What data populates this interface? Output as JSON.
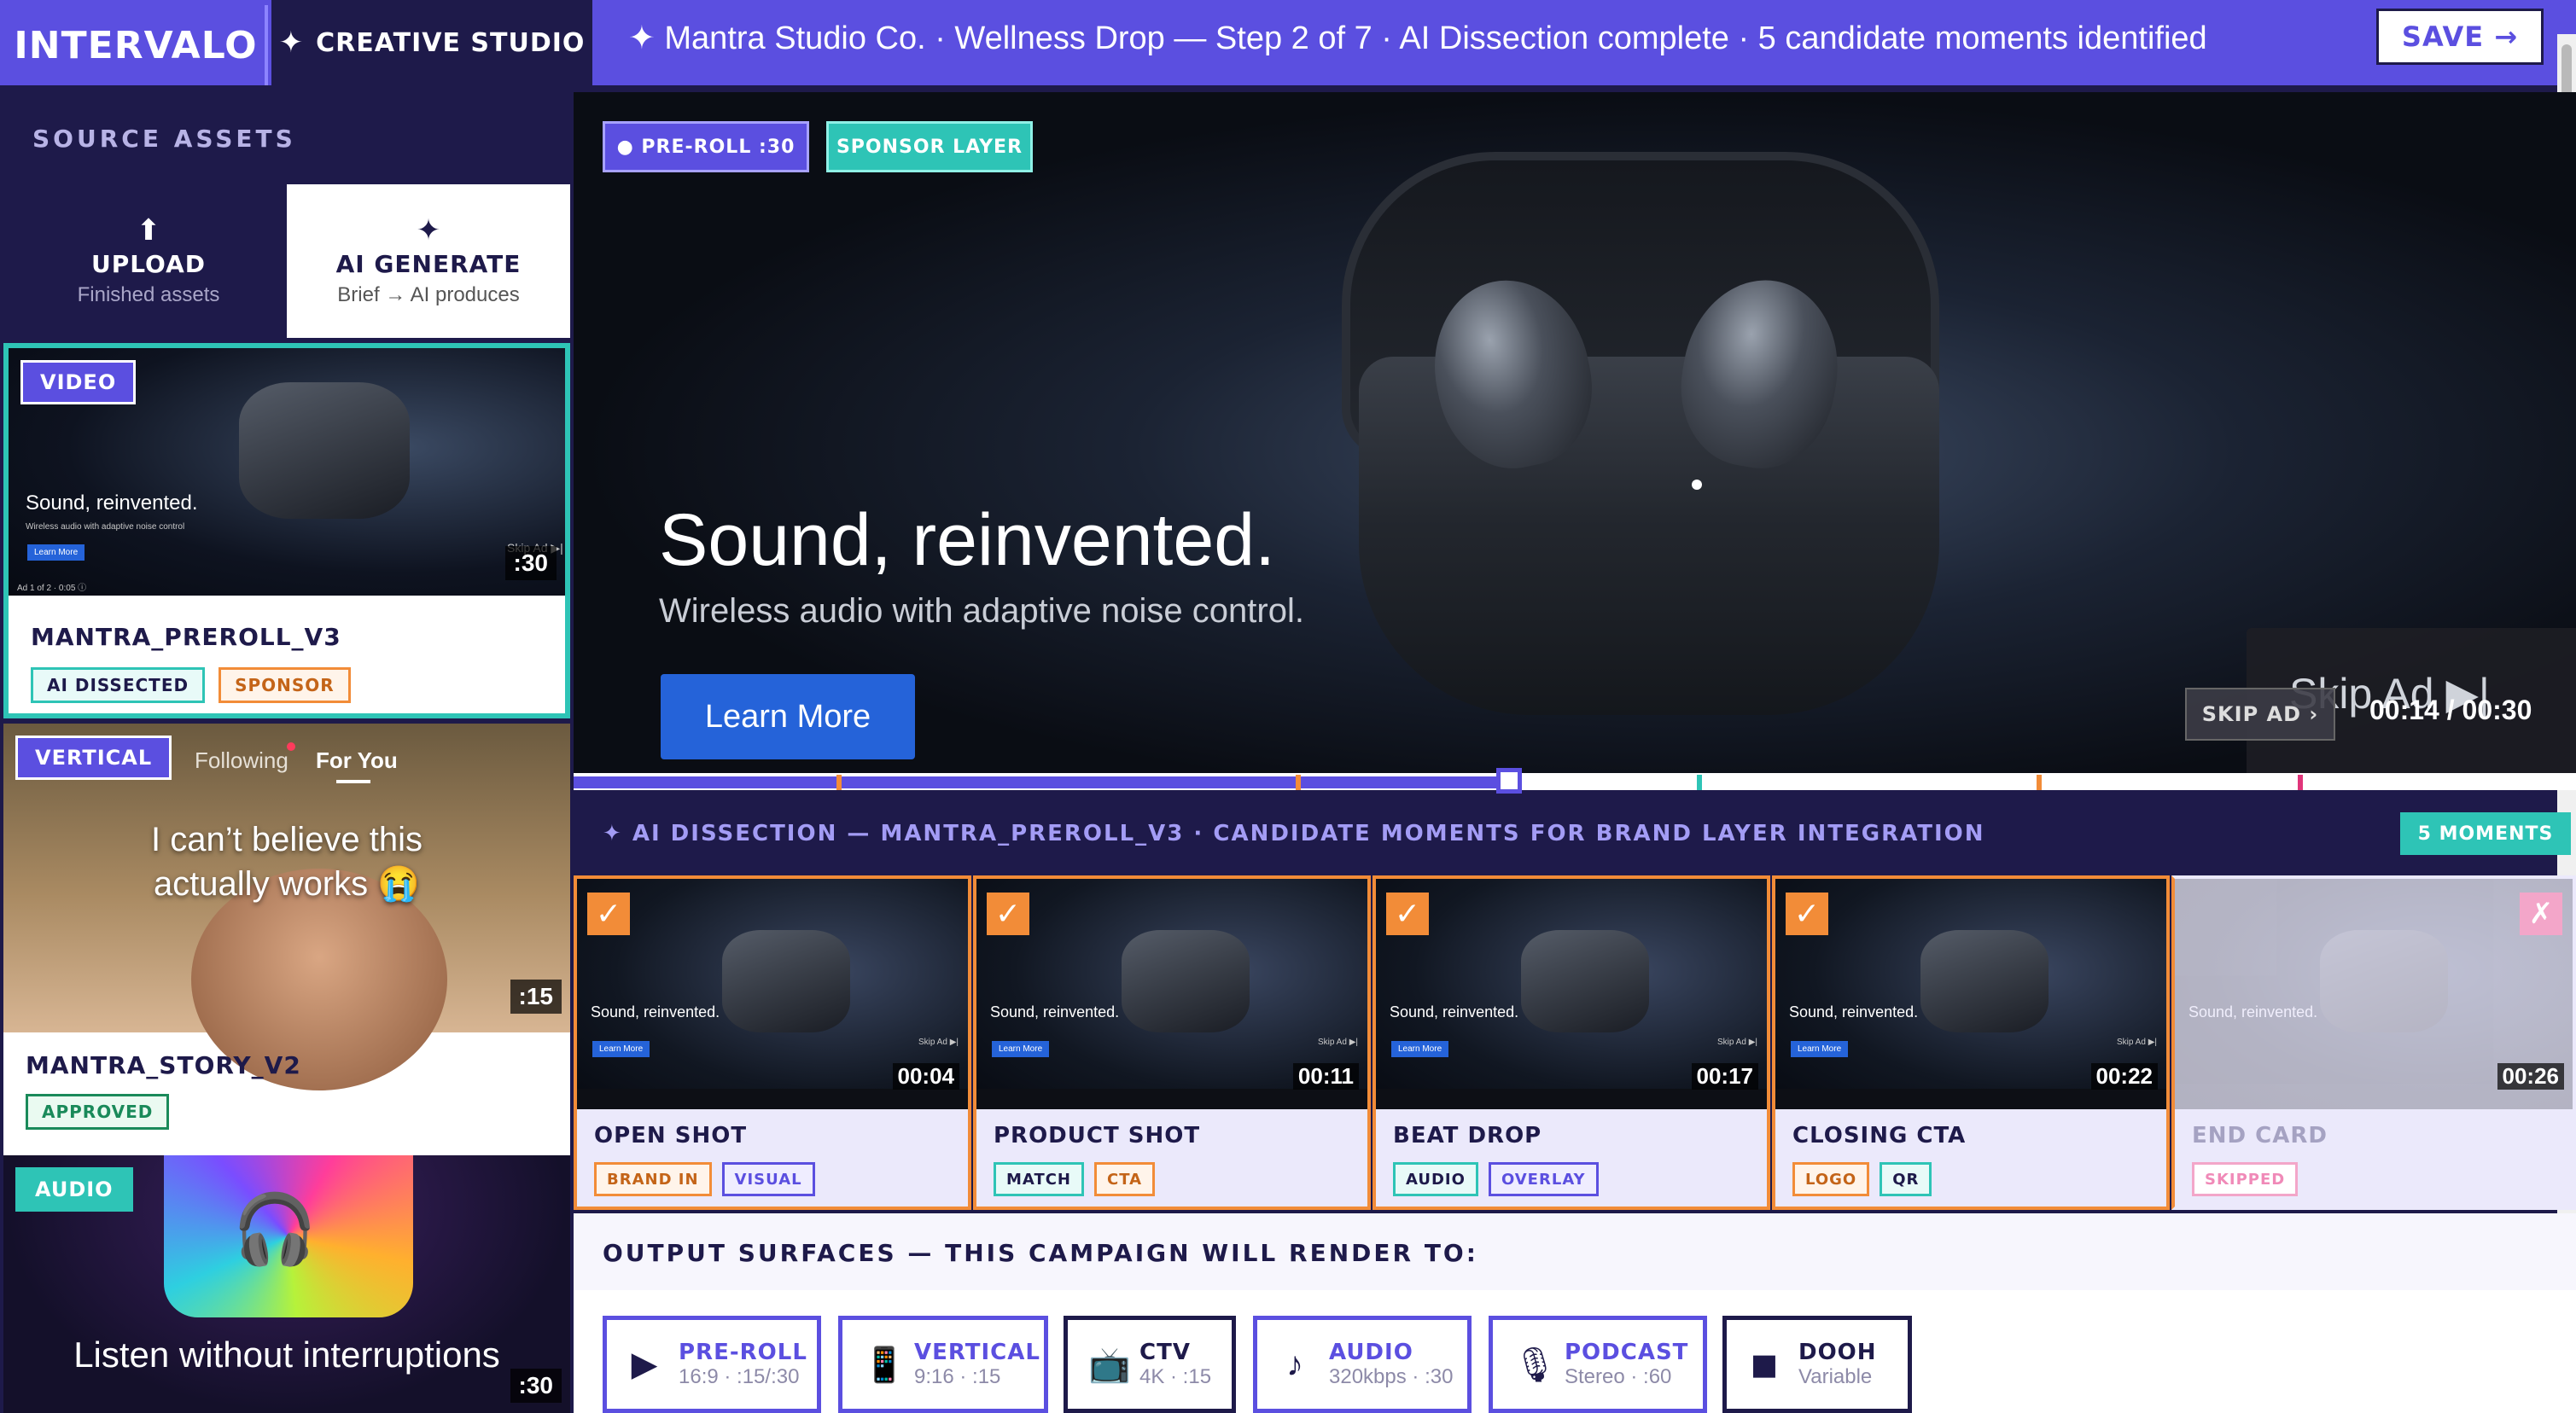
{
  "topbar": {
    "brand": "INTERVALO",
    "studio_icon": "sparkle-icon",
    "studio_star": "✦",
    "studio_label": "CREATIVE STUDIO",
    "breadcrumb": "✦ Mantra Studio Co. · Wellness Drop — Step 2 of 7 · AI Dissection complete · 5 candidate moments identified",
    "save_label": "SAVE →"
  },
  "sidebar": {
    "title": "SOURCE ASSETS",
    "upload": {
      "icon": "⬆",
      "label": "UPLOAD",
      "sub": "Finished assets"
    },
    "ai_generate": {
      "icon": "✦",
      "label": "AI GENERATE",
      "sub": "Brief → AI produces"
    },
    "assets": [
      {
        "type": "VIDEO",
        "duration": ":30",
        "name": "MANTRA_PREROLL_V3",
        "mini_head": "Sound, reinvented.",
        "mini_sub": "Wireless audio with adaptive noise control",
        "mini_cta": "Learn More",
        "mini_skip": "Skip Ad ▶|",
        "mini_meta": "Ad 1 of 2 · 0:05 ⓘ",
        "chips": [
          {
            "label": "AI DISSECTED",
            "color": "#2ec4b6"
          },
          {
            "label": "SPONSOR",
            "color": "#f28c38"
          }
        ]
      },
      {
        "type": "VERTICAL",
        "duration": ":15",
        "name": "MANTRA_STORY_V2",
        "tab_following": "Following",
        "tab_foryou": "For You",
        "caption": "I can’t believe this actually works 😭",
        "chips": [
          {
            "label": "APPROVED",
            "color": "#1a8a5a"
          }
        ]
      },
      {
        "type": "AUDIO",
        "duration": ":30",
        "caption": "Listen without interruptions"
      }
    ]
  },
  "player": {
    "pill_preroll": "● PRE-ROLL :30",
    "pill_sponsor": "SPONSOR LAYER",
    "headline": "Sound, reinvented.",
    "subline": "Wireless audio with adaptive noise control.",
    "cta": "Learn More",
    "skip_big": "Skip Ad ▶|",
    "skip_small": "SKIP AD ›",
    "timecode": "00:14 / 00:30",
    "progress_fraction": 0.467
  },
  "dissection": {
    "title": "✦ AI DISSECTION — MANTRA_PREROLL_V3 · CANDIDATE MOMENTS FOR BRAND LAYER INTEGRATION",
    "badge": "5 MOMENTS",
    "moments": [
      {
        "time": "00:04",
        "title": "OPEN SHOT",
        "selected": true,
        "chips": [
          {
            "label": "BRAND IN",
            "color": "#f28c38"
          },
          {
            "label": "VISUAL",
            "color": "#5b4fe0"
          }
        ]
      },
      {
        "time": "00:11",
        "title": "PRODUCT SHOT",
        "selected": true,
        "chips": [
          {
            "label": "MATCH",
            "color": "#2ec4b6"
          },
          {
            "label": "CTA",
            "color": "#f28c38"
          }
        ]
      },
      {
        "time": "00:17",
        "title": "BEAT DROP",
        "selected": true,
        "chips": [
          {
            "label": "AUDIO",
            "color": "#2ec4b6"
          },
          {
            "label": "OVERLAY",
            "color": "#5b4fe0"
          }
        ]
      },
      {
        "time": "00:22",
        "title": "CLOSING CTA",
        "selected": true,
        "chips": [
          {
            "label": "LOGO",
            "color": "#f28c38"
          },
          {
            "label": "QR",
            "color": "#2ec4b6"
          }
        ]
      },
      {
        "time": "00:26",
        "title": "END CARD",
        "selected": false,
        "chips": [
          {
            "label": "SKIPPED",
            "color": "#f3a6c9"
          }
        ]
      }
    ],
    "check_glyph": "✓",
    "skip_glyph": "✗",
    "mini_head": "Sound, reinvented.",
    "mini_cta": "Learn More",
    "mini_skip": "Skip Ad ▶|"
  },
  "output": {
    "title": "OUTPUT SURFACES — THIS CAMPAIGN WILL RENDER TO:",
    "surfaces": [
      {
        "icon": "▶",
        "name": "PRE-ROLL",
        "spec": "16:9 · :15/:30"
      },
      {
        "icon": "📱",
        "name": "VERTICAL",
        "spec": "9:16 · :15"
      },
      {
        "icon": "📺",
        "name": "CTV",
        "spec": "4K · :15"
      },
      {
        "icon": "♪",
        "name": "AUDIO",
        "spec": "320kbps · :30"
      },
      {
        "icon": "🎙",
        "name": "PODCAST",
        "spec": "Stereo · :60"
      },
      {
        "icon": "◼",
        "name": "DOOH",
        "spec": "Variable"
      }
    ]
  },
  "colors": {
    "primary": "#5b4fe0",
    "navy": "#1e1a4a",
    "teal": "#2ec4b6",
    "orange": "#f28c38",
    "pink": "#f3a6c9"
  }
}
